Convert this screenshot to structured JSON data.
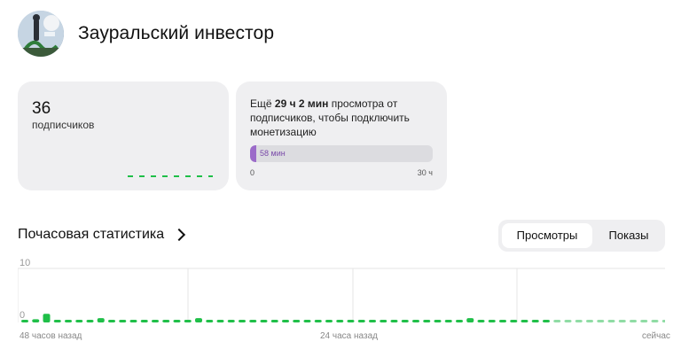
{
  "channel": {
    "name": "Зауральский инвестор"
  },
  "subscribers": {
    "count": "36",
    "label": "подписчиков"
  },
  "monetization": {
    "prefix": "Ещё",
    "remaining": "29 ч 2 мин",
    "suffix": "просмотра от подписчиков, чтобы подключить монетизацию",
    "progress_label": "58 мин",
    "progress_min": "0",
    "progress_max": "30 ч",
    "progress_fraction": 0.032
  },
  "hourly": {
    "title": "Почасовая статистика",
    "tabs": [
      {
        "label": "Просмотры",
        "active": true
      },
      {
        "label": "Показы",
        "active": false
      }
    ]
  },
  "chart_data": {
    "type": "bar",
    "ylim": [
      0,
      10
    ],
    "y_ticks": [
      "10",
      "0"
    ],
    "x_labels": [
      "48 часов назад",
      "24 часа назад",
      "сейчас"
    ],
    "values": [
      0,
      0.6,
      1.6,
      0,
      0,
      0,
      0,
      0.8,
      0,
      0,
      0,
      0,
      0,
      0,
      0,
      0,
      0.8,
      0,
      0,
      0,
      0,
      0,
      0,
      0,
      0,
      0,
      0,
      0,
      0,
      0,
      0,
      0,
      0,
      0,
      0,
      0,
      0,
      0,
      0,
      0,
      0,
      0.8,
      0,
      0,
      0,
      0,
      0,
      0,
      0,
      0,
      0,
      0,
      0,
      0,
      0,
      0,
      0,
      0,
      0,
      0,
      0,
      0
    ],
    "faded_from": 49
  },
  "colors": {
    "bar": "#1fbf48",
    "bar_faded": "#8fdca4",
    "accent": "#9b6bc9"
  }
}
